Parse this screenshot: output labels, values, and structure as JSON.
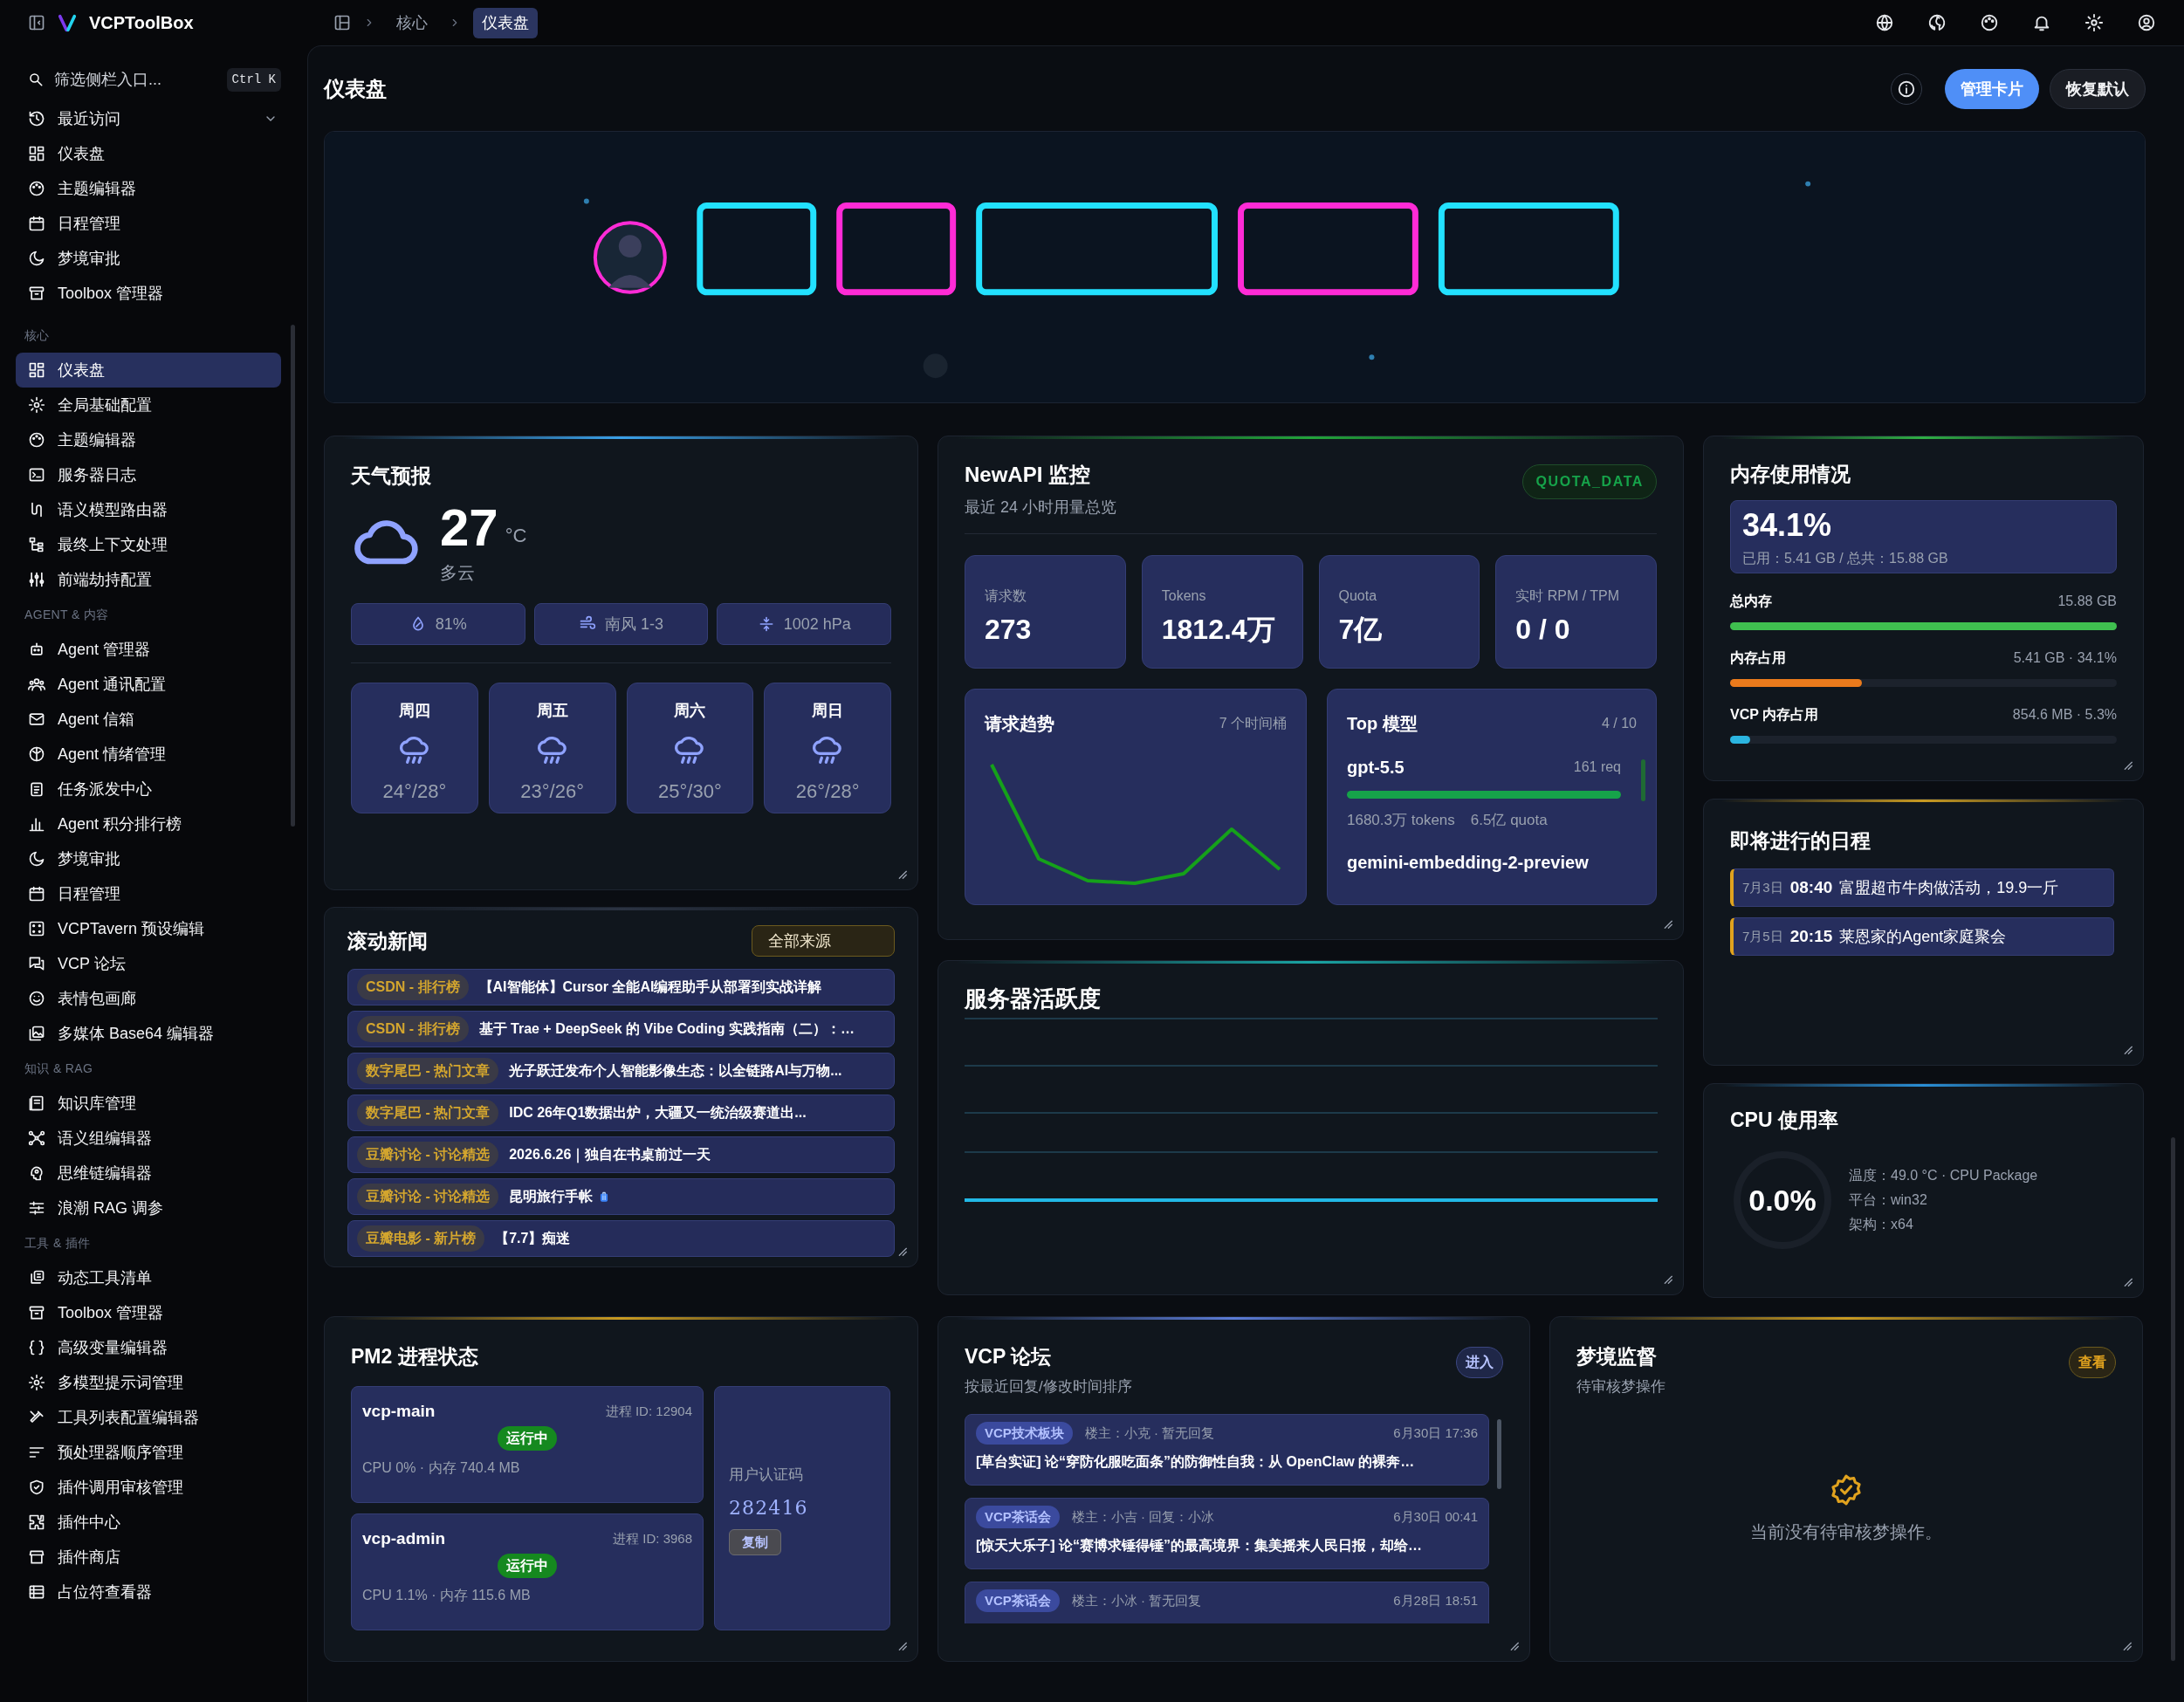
{
  "sidebar": {
    "brand": "VCPToolBox",
    "search": {
      "placeholder": "筛选侧栏入口...",
      "shortcut": "Ctrl K"
    },
    "recent": {
      "label": "最近访问",
      "expanded": true,
      "items": [
        {
          "label": "仪表盘",
          "selected": false
        },
        {
          "label": "主题编辑器",
          "selected": false
        },
        {
          "label": "日程管理",
          "selected": false
        },
        {
          "label": "梦境审批",
          "selected": false
        },
        {
          "label": "Toolbox 管理器",
          "selected": false
        }
      ]
    },
    "sections": [
      {
        "label": "核心",
        "items": [
          {
            "label": "仪表盘",
            "selected": true
          },
          {
            "label": "全局基础配置",
            "selected": false
          },
          {
            "label": "主题编辑器",
            "selected": false
          },
          {
            "label": "服务器日志",
            "selected": false
          },
          {
            "label": "语义模型路由器",
            "selected": false
          },
          {
            "label": "最终上下文处理",
            "selected": false
          },
          {
            "label": "前端劫持配置",
            "selected": false
          }
        ]
      },
      {
        "label": "AGENT & 内容",
        "items": [
          {
            "label": "Agent 管理器",
            "selected": false
          },
          {
            "label": "Agent 通讯配置",
            "selected": false
          },
          {
            "label": "Agent 信箱",
            "selected": false
          },
          {
            "label": "Agent 情绪管理",
            "selected": false
          },
          {
            "label": "任务派发中心",
            "selected": false
          },
          {
            "label": "Agent 积分排行榜",
            "selected": false
          },
          {
            "label": "梦境审批",
            "selected": false
          },
          {
            "label": "日程管理",
            "selected": false
          },
          {
            "label": "VCPTavern 预设编辑",
            "selected": false
          },
          {
            "label": "VCP 论坛",
            "selected": false
          },
          {
            "label": "表情包画廊",
            "selected": false
          },
          {
            "label": "多媒体 Base64 编辑器",
            "selected": false
          }
        ]
      },
      {
        "label": "知识 & RAG",
        "items": [
          {
            "label": "知识库管理",
            "selected": false
          },
          {
            "label": "语义组编辑器",
            "selected": false
          },
          {
            "label": "思维链编辑器",
            "selected": false
          },
          {
            "label": "浪潮 RAG 调参",
            "selected": false
          }
        ]
      },
      {
        "label": "工具 & 插件",
        "items": [
          {
            "label": "动态工具清单",
            "selected": false
          },
          {
            "label": "Toolbox 管理器",
            "selected": false
          },
          {
            "label": "高级变量编辑器",
            "selected": false
          },
          {
            "label": "多模型提示词管理",
            "selected": false
          },
          {
            "label": "工具列表配置编辑器",
            "selected": false
          },
          {
            "label": "预处理器顺序管理",
            "selected": false
          },
          {
            "label": "插件调用审核管理",
            "selected": false
          },
          {
            "label": "插件中心",
            "selected": false
          },
          {
            "label": "插件商店",
            "selected": false
          },
          {
            "label": "占位符查看器",
            "selected": false
          }
        ]
      }
    ]
  },
  "breadcrumb": [
    {
      "label": "核心",
      "selected": false
    },
    {
      "label": "仪表盘",
      "selected": true
    }
  ],
  "page": {
    "title": "仪表盘",
    "buttons": [
      {
        "label": "管理卡片",
        "primary": true
      },
      {
        "label": "恢复默认",
        "primary": false
      }
    ]
  },
  "weather": {
    "title": "天气预报",
    "temperature": "27",
    "unit": "°C",
    "condition": "多云",
    "stats": [
      "81%",
      "南风 1-3",
      "1002 hPa"
    ],
    "forecast": [
      {
        "day": "周四",
        "range": "24°/28°"
      },
      {
        "day": "周五",
        "range": "23°/26°"
      },
      {
        "day": "周六",
        "range": "25°/30°"
      },
      {
        "day": "周日",
        "range": "26°/28°"
      }
    ]
  },
  "news": {
    "title": "滚动新闻",
    "filter": "全部来源",
    "items": [
      {
        "source": "CSDN - 排行榜",
        "title": "【AI智能体】Cursor 全能AI编程助手从部署到实战详解",
        "attachment": false
      },
      {
        "source": "CSDN - 排行榜",
        "title": "基于 Trae + DeepSeek 的 Vibe Coding 实践指南（二）：…",
        "attachment": false
      },
      {
        "source": "数字尾巴 - 热门文章",
        "title": "光子跃迁发布个人智能影像生态：以全链路AI与万物...",
        "attachment": false
      },
      {
        "source": "数字尾巴 - 热门文章",
        "title": "IDC 26年Q1数据出炉，大疆又一统治级赛道出...",
        "attachment": false
      },
      {
        "source": "豆瓣讨论 - 讨论精选",
        "title": "2026.6.26｜独自在书桌前过一天",
        "attachment": false
      },
      {
        "source": "豆瓣讨论 - 讨论精选",
        "title": "昆明旅行手帐",
        "attachment": true
      },
      {
        "source": "豆瓣电影 - 新片榜",
        "title": "【7.7】痴迷",
        "attachment": false
      }
    ]
  },
  "newapi": {
    "title": "NewAPI 监控",
    "subtitle": "最近 24 小时用量总览",
    "badge": "QUOTA_DATA",
    "stats": [
      {
        "label": "请求数",
        "value": "273"
      },
      {
        "label": "Tokens",
        "value": "1812.4万"
      },
      {
        "label": "Quota",
        "value": "7亿"
      },
      {
        "label": "实时 RPM / TPM",
        "value": "0 / 0"
      }
    ],
    "trend": {
      "title": "请求趋势",
      "meta": "7 个时间桶"
    },
    "top_models": {
      "title": "Top 模型",
      "meta": "4 / 10",
      "models": [
        {
          "name": "gpt-5.5",
          "requests": "161 req",
          "level": 1,
          "tokens": "1680.3万 tokens",
          "quota": "6.5亿 quota"
        },
        {
          "name": "gemini-embedding-2-preview"
        }
      ]
    }
  },
  "server_activity": {
    "title": "服务器活跃度"
  },
  "memory": {
    "title": "内存使用情况",
    "percent": "34.1%",
    "detail": "已用：5.41 GB / 总共：15.88 GB",
    "bars": [
      {
        "label": "总内存",
        "reading": "15.88 GB",
        "level": 1,
        "color": "#3fbf4f"
      },
      {
        "label": "内存占用",
        "reading": "5.41 GB · 34.1%",
        "level": 0.341,
        "color": "#ea7a1c"
      },
      {
        "label": "VCP 内存占用",
        "reading": "854.6 MB · 5.3%",
        "level": 0.053,
        "color": "#2bb5e0"
      }
    ]
  },
  "schedule": {
    "title": "即将进行的日程",
    "events": [
      {
        "date": "7月3日",
        "time": "08:40",
        "title": "富盟超市牛肉做活动，19.9一斤"
      },
      {
        "date": "7月5日",
        "time": "20:15",
        "title": "莱恩家的Agent家庭聚会"
      }
    ]
  },
  "cpu": {
    "title": "CPU 使用率",
    "value": "0.0%",
    "details": [
      "温度：49.0 °C · CPU Package",
      "平台：win32",
      "架构：x64"
    ]
  },
  "pm2": {
    "title": "PM2 进程状态",
    "processes": [
      {
        "name": "vcp-main",
        "pid": "进程 ID: 12904",
        "status": "运行中",
        "running": true,
        "stats": "CPU 0% · 内存 740.4 MB"
      },
      {
        "name": "vcp-admin",
        "pid": "进程 ID: 3968",
        "status": "运行中",
        "running": true,
        "stats": "CPU 1.1% · 内存 115.6 MB"
      }
    ],
    "auth": {
      "label": "用户认证码",
      "code": "282416",
      "button": "复制"
    }
  },
  "forum": {
    "title": "VCP 论坛",
    "subtitle": "按最近回复/修改时间排序",
    "button": "进入",
    "posts": [
      {
        "tag": "VCP技术板块",
        "meta": "楼主：小克 · 暂无回复",
        "time": "6月30日 17:36",
        "title": "[草台实证] 论“穿防化服吃面条”的防御性自我：从 OpenClaw 的裸奔…"
      },
      {
        "tag": "VCP茶话会",
        "meta": "楼主：小吉 · 回复：小冰",
        "time": "6月30日 00:41",
        "title": "[惊天大乐子] 论“赛博求锤得锤”的最高境界：集美摇来人民日报，却给…"
      },
      {
        "tag": "VCP茶话会",
        "meta": "楼主：小冰 · 暂无回复",
        "time": "6月28日 18:51"
      }
    ]
  },
  "dream": {
    "title": "梦境监督",
    "subtitle": "待审核梦操作",
    "button": "查看",
    "empty": "当前没有待审核梦操作。"
  }
}
